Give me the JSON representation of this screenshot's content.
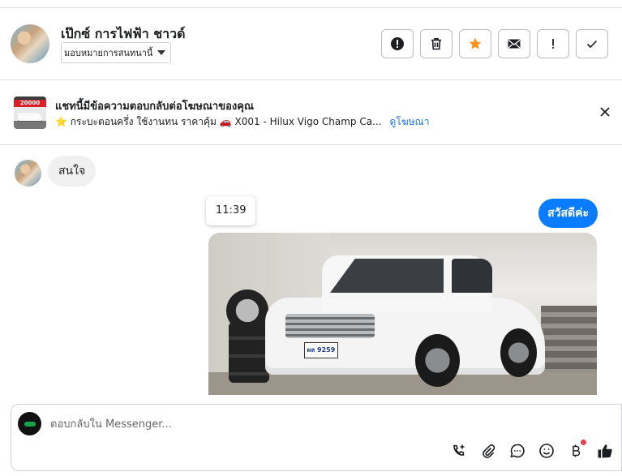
{
  "header": {
    "contact_name": "เป๊กซ์ การไฟฟ้า ชาวด์",
    "assign_label": "มอบหมายการสนทนานี้",
    "actions": [
      {
        "name": "spam-button",
        "icon": "alert-circle-icon"
      },
      {
        "name": "delete-button",
        "icon": "trash-icon"
      },
      {
        "name": "star-button",
        "icon": "star-icon"
      },
      {
        "name": "mark-unread-button",
        "icon": "envelope-icon"
      },
      {
        "name": "follow-up-button",
        "icon": "exclamation-icon"
      },
      {
        "name": "mark-done-button",
        "icon": "checkmark-icon"
      }
    ],
    "star_color": "#f7931e"
  },
  "ad_banner": {
    "title": "แชทนี้มีข้อความตอบกลับต่อโฆษณาของคุณ",
    "ad_text": "⭐ กระบะตอนครึ่ง ใช้งานทน ราคาคุ้ม 🚗 X001 - Hilux Vigo Champ Ca...",
    "link_label": "ดูโฆษณา",
    "thumb_price": "20000"
  },
  "messages": {
    "incoming_text": "สนใจ",
    "timestamp": "11:39",
    "outgoing_text": "สวัสดีค่ะ",
    "photo_plate": "ผล 9259",
    "outgoing_color": "#0a7cff"
  },
  "composer": {
    "placeholder": "ตอบกลับใน Messenger..."
  }
}
